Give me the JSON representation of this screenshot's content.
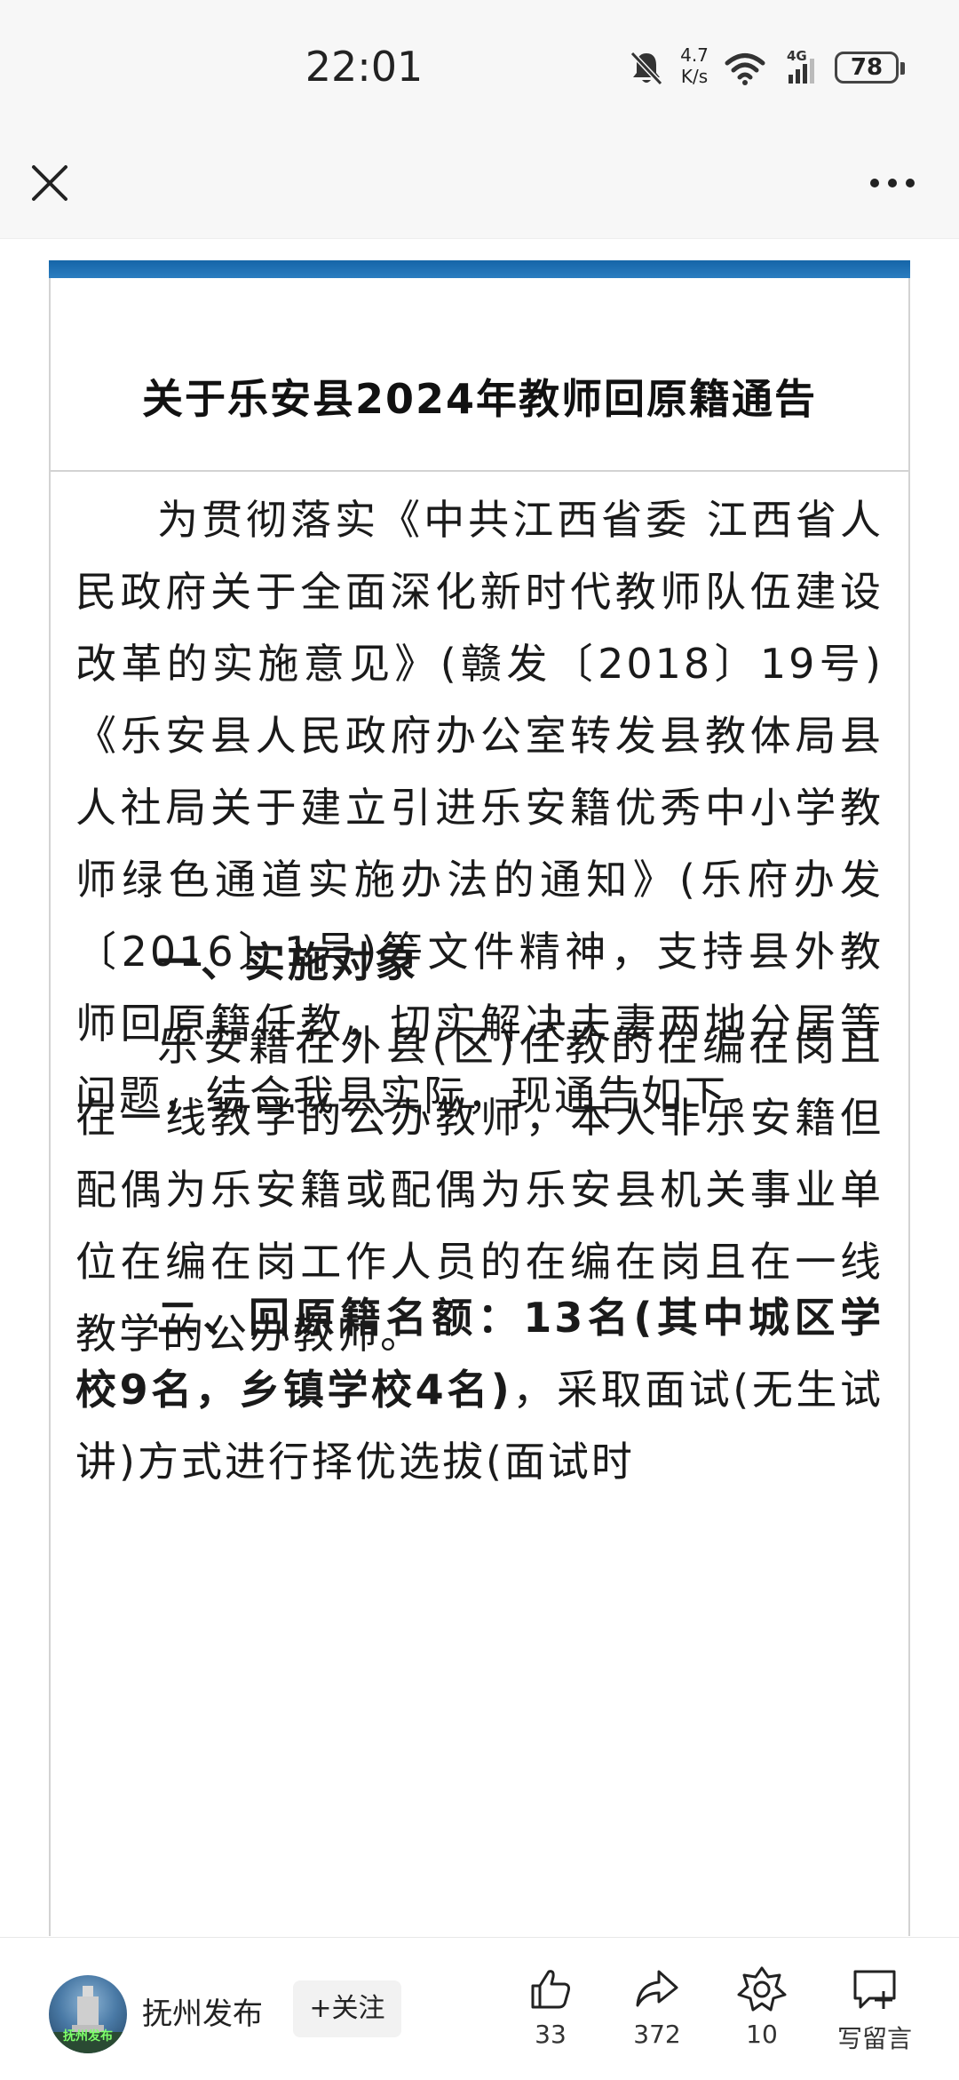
{
  "status_bar": {
    "time": "22:01",
    "net_speed_value": "4.7",
    "net_speed_unit": "K/s",
    "network": "4G",
    "battery": "78",
    "icons": [
      "bell-muted-icon",
      "wifi-icon",
      "signal-icon",
      "battery-icon"
    ]
  },
  "top_bar": {
    "close_icon": "close-icon",
    "more_icon": "more-icon"
  },
  "article": {
    "title": "关于乐安县2024年教师回原籍通告",
    "paragraph_1": "为贯彻落实《中共江西省委 江西省人民政府关于全面深化新时代教师队伍建设改革的实施意见》(赣发〔2018〕19号)《乐安县人民政府办公室转发县教体局县人社局关于建立引进乐安籍优秀中小学教师绿色通道实施办法的通知》(乐府办发〔2016〕1号)等文件精神，支持县外教师回原籍任教，切实解决夫妻两地分居等问题，结合我县实际，现通告如下。",
    "heading_1": "一、实施对象",
    "paragraph_2": "乐安籍在外县(区)任教的在编在岗且在一线教学的公办教师，本人非乐安籍但配偶为乐安籍或配偶为乐安县机关事业单位在编在岗工作人员的在编在岗且在一线教学的公办教师。",
    "heading_2_bold": "二、回原籍名额：13名(其中城区学校9名，乡镇学校4名)",
    "heading_2_rest": "，采取面试(无生试讲)方式进行择优选拔(面试时"
  },
  "bottom_bar": {
    "account_name": "抚州发布",
    "avatar_text": "抚州发布",
    "follow_label": "+关注",
    "like_count": "33",
    "share_count": "372",
    "favorite_count": "10",
    "comment_label": "写留言",
    "colors": {
      "accent_blue": "#1565a8"
    }
  }
}
